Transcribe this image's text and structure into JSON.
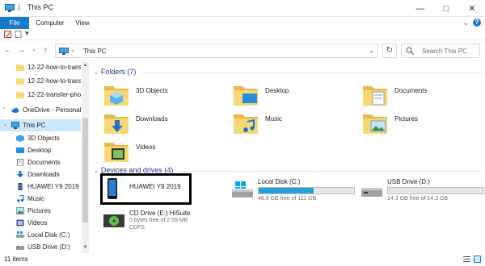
{
  "window": {
    "title": "This PC"
  },
  "ribbon": {
    "tabs": [
      "File",
      "Computer",
      "View"
    ]
  },
  "address": {
    "path": "This PC",
    "search_placeholder": "Search This PC"
  },
  "sidebar": {
    "items": [
      {
        "label": "12-22-how-to-transf",
        "icon": "folder-icon"
      },
      {
        "label": "12-22-how-to-transf",
        "icon": "folder-icon"
      },
      {
        "label": "12-22-transfer-photo",
        "icon": "folder-icon"
      },
      {
        "label": "OneDrive - Personal",
        "icon": "onedrive-icon"
      },
      {
        "label": "This PC",
        "icon": "this-pc-icon",
        "selected": true
      },
      {
        "label": "3D Objects",
        "icon": "3d-objects-icon"
      },
      {
        "label": "Desktop",
        "icon": "desktop-icon"
      },
      {
        "label": "Documents",
        "icon": "documents-icon"
      },
      {
        "label": "Downloads",
        "icon": "downloads-icon"
      },
      {
        "label": "HUAWEI Y9 2019",
        "icon": "phone-icon"
      },
      {
        "label": "Music",
        "icon": "music-icon"
      },
      {
        "label": "Pictures",
        "icon": "pictures-icon"
      },
      {
        "label": "Videos",
        "icon": "videos-icon"
      },
      {
        "label": "Local Disk (C:)",
        "icon": "local-disk-icon"
      },
      {
        "label": "USB Drive (D:)",
        "icon": "usb-drive-icon"
      }
    ]
  },
  "folders": {
    "header": "Folders (7)",
    "items": [
      {
        "label": "3D Objects",
        "icon": "3d-objects-folder-icon"
      },
      {
        "label": "Desktop",
        "icon": "desktop-folder-icon"
      },
      {
        "label": "Documents",
        "icon": "documents-folder-icon"
      },
      {
        "label": "Downloads",
        "icon": "downloads-folder-icon"
      },
      {
        "label": "Music",
        "icon": "music-folder-icon"
      },
      {
        "label": "Pictures",
        "icon": "pictures-folder-icon"
      },
      {
        "label": "Videos",
        "icon": "videos-folder-icon"
      }
    ]
  },
  "drives": {
    "header": "Devices and drives (4)",
    "items": [
      {
        "name": "HUAWEI Y9 2019",
        "icon": "phone-icon",
        "highlighted": true
      },
      {
        "name": "Local Disk (C:)",
        "free": "46.9 GB free of 111 GB",
        "used_fraction": 0.58,
        "icon": "local-disk-icon"
      },
      {
        "name": "USB Drive (D:)",
        "free": "14.3 GB free of 14.3 GB",
        "used_fraction": 0.0,
        "icon": "usb-drive-icon"
      },
      {
        "name": "CD Drive (E:) HiSuite",
        "free": "0 bytes free of 2.59 MB",
        "fs": "CDFS",
        "icon": "cd-drive-icon"
      }
    ]
  },
  "status": {
    "items": "11 items"
  },
  "colors": {
    "accent": "#1979ca",
    "selection": "#cce8ff",
    "bar_fill": "#26a0da",
    "folder": "#f8d775"
  }
}
